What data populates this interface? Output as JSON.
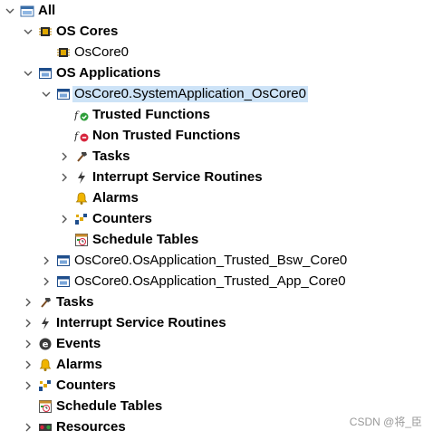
{
  "tree": {
    "all": "All",
    "os_cores": "OS Cores",
    "oscore0": "OsCore0",
    "os_applications": "OS Applications",
    "app_system": "OsCore0.SystemApplication_OsCore0",
    "trusted_functions": "Trusted Functions",
    "non_trusted_functions": "Non Trusted Functions",
    "tasks": "Tasks",
    "isr": "Interrupt Service Routines",
    "alarms": "Alarms",
    "counters": "Counters",
    "schedule_tables": "Schedule Tables",
    "app_bsw": "OsCore0.OsApplication_Trusted_Bsw_Core0",
    "app_app": "OsCore0.OsApplication_Trusted_App_Core0",
    "root_tasks": "Tasks",
    "root_isr": "Interrupt Service Routines",
    "root_events": "Events",
    "root_alarms": "Alarms",
    "root_counters": "Counters",
    "root_schedule_tables": "Schedule Tables",
    "root_resources": "Resources"
  },
  "watermark": "CSDN @将_臣",
  "colors": {
    "selection": "#cde3f7",
    "chevron": "#555555"
  }
}
